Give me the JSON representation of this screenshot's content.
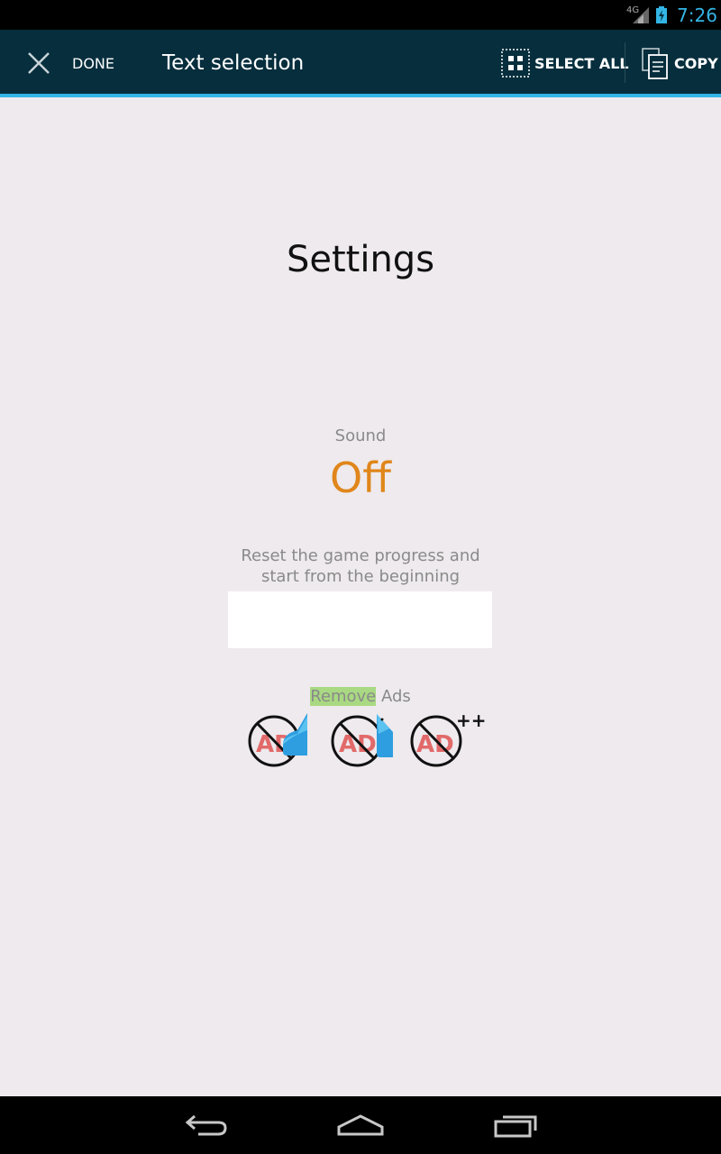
{
  "status_bar": {
    "network": "4G",
    "time": "7:26"
  },
  "action_bar": {
    "done_label": "DONE",
    "title": "Text selection",
    "select_all_label": "SELECT ALL",
    "copy_label": "COPY"
  },
  "settings": {
    "title": "Settings",
    "sound_label": "Sound",
    "sound_value": "Off",
    "reset_text_line1": "Reset the game progress and",
    "reset_text_line2": "start from the beginning",
    "ads_selected": "Remove",
    "ads_rest": " Ads",
    "ad_icons": [
      {
        "name": "remove-ads-icon",
        "text": "AD"
      },
      {
        "name": "remove-ads-icon",
        "text": "AD"
      },
      {
        "name": "remove-ads-plus-icon",
        "text": "AD",
        "badge": "++"
      }
    ]
  },
  "colors": {
    "accent": "#33b5e5",
    "action_bar": "#062e3d",
    "sound_value": "#e0861a",
    "selection": "#a9d982",
    "background": "#eeeaed"
  }
}
